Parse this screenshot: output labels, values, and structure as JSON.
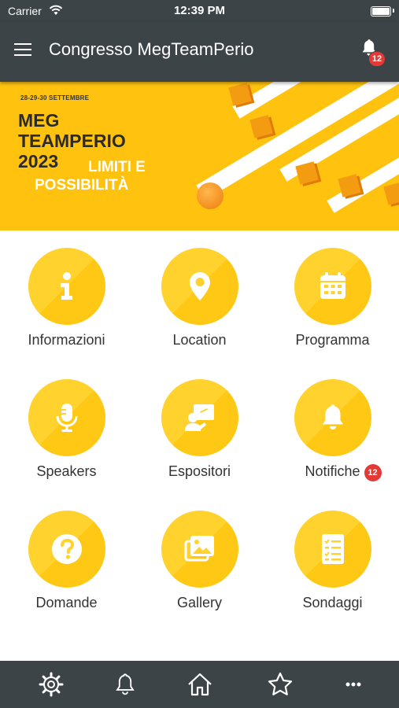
{
  "status_bar": {
    "carrier": "Carrier",
    "time": "12:39 PM"
  },
  "header": {
    "title": "Congresso MegTeamPerio",
    "notification_count": "12"
  },
  "banner": {
    "dates": "28-29-30 SETTEMBRE",
    "event_name": "MEG TEAMPERIO 2023",
    "subtitle_line1": "LIMITI E",
    "subtitle_line2": "POSSIBILITÀ"
  },
  "tiles": [
    {
      "label": "Informazioni",
      "icon": "info-icon"
    },
    {
      "label": "Location",
      "icon": "location-pin-icon"
    },
    {
      "label": "Programma",
      "icon": "calendar-icon"
    },
    {
      "label": "Speakers",
      "icon": "microphone-icon"
    },
    {
      "label": "Espositori",
      "icon": "presenter-board-icon"
    },
    {
      "label": "Notifiche",
      "icon": "bell-icon",
      "badge": "12"
    },
    {
      "label": "Domande",
      "icon": "question-icon"
    },
    {
      "label": "Gallery",
      "icon": "gallery-images-icon"
    },
    {
      "label": "Sondaggi",
      "icon": "survey-list-icon"
    }
  ],
  "bottom_nav": [
    "gear-icon",
    "bell-icon",
    "home-icon",
    "star-icon",
    "more-dots-icon"
  ],
  "colors": {
    "bar": "#3d4447",
    "accent": "#ffc20e",
    "tile": "#ffd22e",
    "badge": "#e53935"
  }
}
